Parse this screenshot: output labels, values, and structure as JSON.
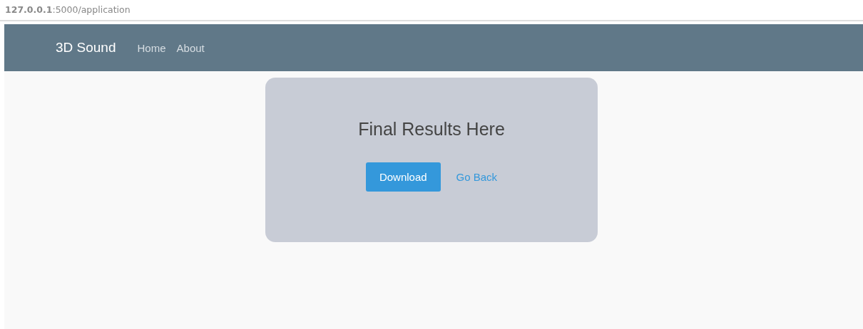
{
  "address_bar": {
    "url": "**127.0.0.1**:5000/application"
  },
  "navbar": {
    "brand": "3D Sound",
    "links": [
      {
        "label": "Home"
      },
      {
        "label": "About"
      }
    ]
  },
  "card": {
    "title": "Final Results Here",
    "buttons": [
      {
        "kind": "primary",
        "label": "Download"
      },
      {
        "kind": "link",
        "label": "Go Back"
      }
    ]
  }
}
